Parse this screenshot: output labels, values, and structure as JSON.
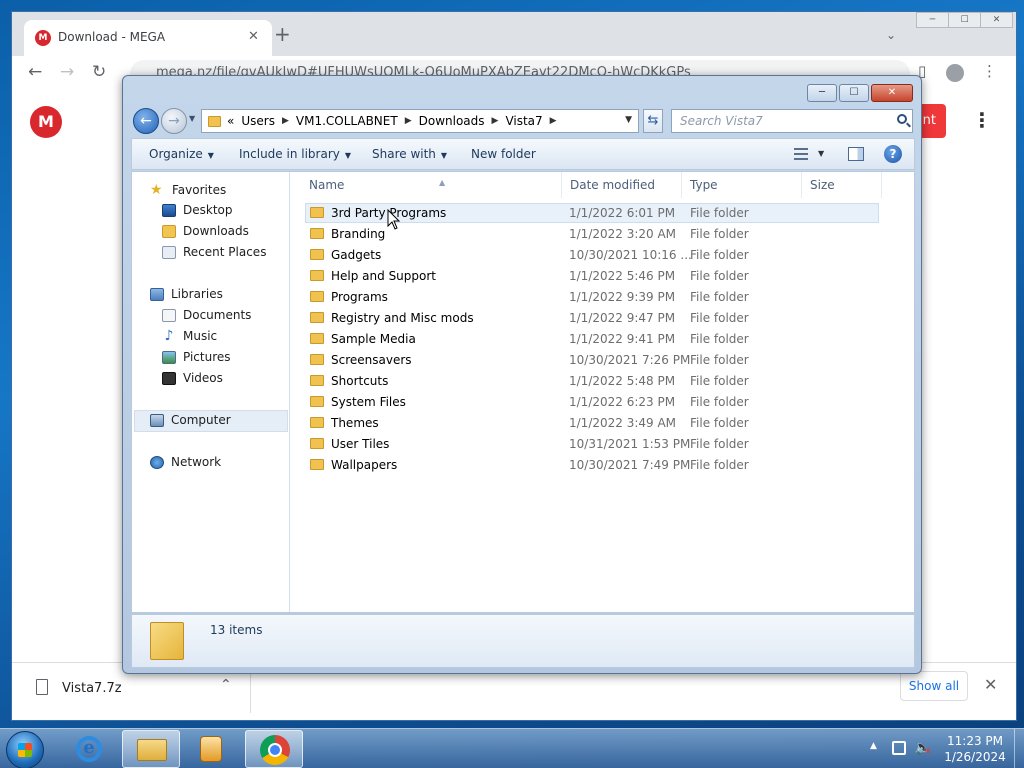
{
  "browser": {
    "tab_title": "Download - MEGA",
    "tab_favicon_letter": "M",
    "new_tab_glyph": "+",
    "url": "mega.nz/file/gvAUkJwD#UFHUWsUOMLk-O6UoMuPXAbZEayt22DMcQ-hWcDKkGPs",
    "window_controls": [
      "─",
      "☐",
      "✕"
    ]
  },
  "mega": {
    "logo_letter": "M",
    "action_button_fragment": "nt"
  },
  "download_bar": {
    "file_name": "Vista7.7z",
    "show_all_label": "Show all"
  },
  "explorer": {
    "window_controls": [
      "─",
      "☐",
      "✕"
    ],
    "breadcrumb": [
      "«",
      "Users",
      "VM1.COLLABNET",
      "Downloads",
      "Vista7"
    ],
    "search_placeholder": "Search Vista7",
    "commands": {
      "organize": "Organize",
      "include_in_library": "Include in library",
      "share_with": "Share with",
      "new_folder": "New folder"
    },
    "navigation": {
      "favorites": "Favorites",
      "desktop": "Desktop",
      "downloads": "Downloads",
      "recent_places": "Recent Places",
      "libraries": "Libraries",
      "documents": "Documents",
      "music": "Music",
      "pictures": "Pictures",
      "videos": "Videos",
      "computer": "Computer",
      "network": "Network"
    },
    "columns": {
      "name": "Name",
      "date_modified": "Date modified",
      "type": "Type",
      "size": "Size"
    },
    "files": [
      {
        "name": "3rd Party Programs",
        "date": "1/1/2022 6:01 PM",
        "type": "File folder"
      },
      {
        "name": "Branding",
        "date": "1/1/2022 3:20 AM",
        "type": "File folder"
      },
      {
        "name": "Gadgets",
        "date": "10/30/2021 10:16 ...",
        "type": "File folder"
      },
      {
        "name": "Help and Support",
        "date": "1/1/2022 5:46 PM",
        "type": "File folder"
      },
      {
        "name": "Programs",
        "date": "1/1/2022 9:39 PM",
        "type": "File folder"
      },
      {
        "name": "Registry and Misc mods",
        "date": "1/1/2022 9:47 PM",
        "type": "File folder"
      },
      {
        "name": "Sample Media",
        "date": "1/1/2022 9:41 PM",
        "type": "File folder"
      },
      {
        "name": "Screensavers",
        "date": "10/30/2021 7:26 PM",
        "type": "File folder"
      },
      {
        "name": "Shortcuts",
        "date": "1/1/2022 5:48 PM",
        "type": "File folder"
      },
      {
        "name": "System Files",
        "date": "1/1/2022 6:23 PM",
        "type": "File folder"
      },
      {
        "name": "Themes",
        "date": "1/1/2022 3:49 AM",
        "type": "File folder"
      },
      {
        "name": "User Tiles",
        "date": "10/31/2021 1:53 PM",
        "type": "File folder"
      },
      {
        "name": "Wallpapers",
        "date": "10/30/2021 7:49 PM",
        "type": "File folder"
      }
    ],
    "item_count": "13 items"
  },
  "taskbar": {
    "time": "11:23 PM",
    "date": "1/26/2024"
  }
}
